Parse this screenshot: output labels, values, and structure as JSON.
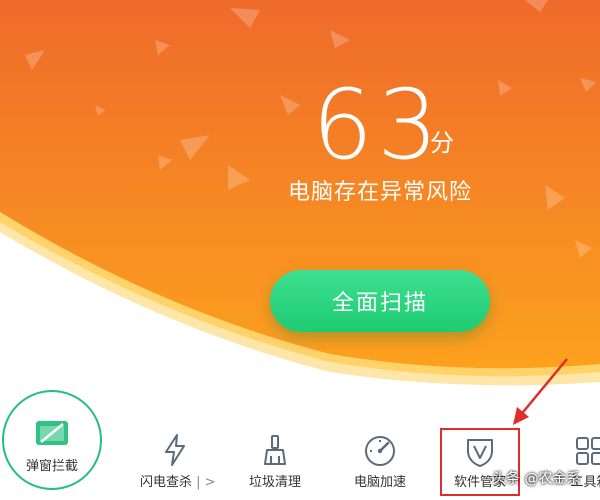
{
  "score": {
    "value": "63",
    "unit": "分",
    "risk_text": "电脑存在异常风险"
  },
  "scan_button": {
    "label": "全面扫描"
  },
  "tools": {
    "popup_block": {
      "label": "弹窗拦截"
    },
    "flash_check": {
      "label": "闪电查杀",
      "chevron": "|  >"
    },
    "trash_clean": {
      "label": "垃圾清理"
    },
    "pc_speed": {
      "label": "电脑加速"
    },
    "soft_manage": {
      "label": "软件管家"
    },
    "toolbox": {
      "label": "工具箱"
    }
  },
  "watermark": {
    "text": "头条 @农金系"
  },
  "colors": {
    "hero_orange_top": "#f06a2a",
    "hero_orange_bottom": "#fba41e",
    "scan_green": "#2dd47e",
    "highlight_red": "#e42b2b"
  }
}
